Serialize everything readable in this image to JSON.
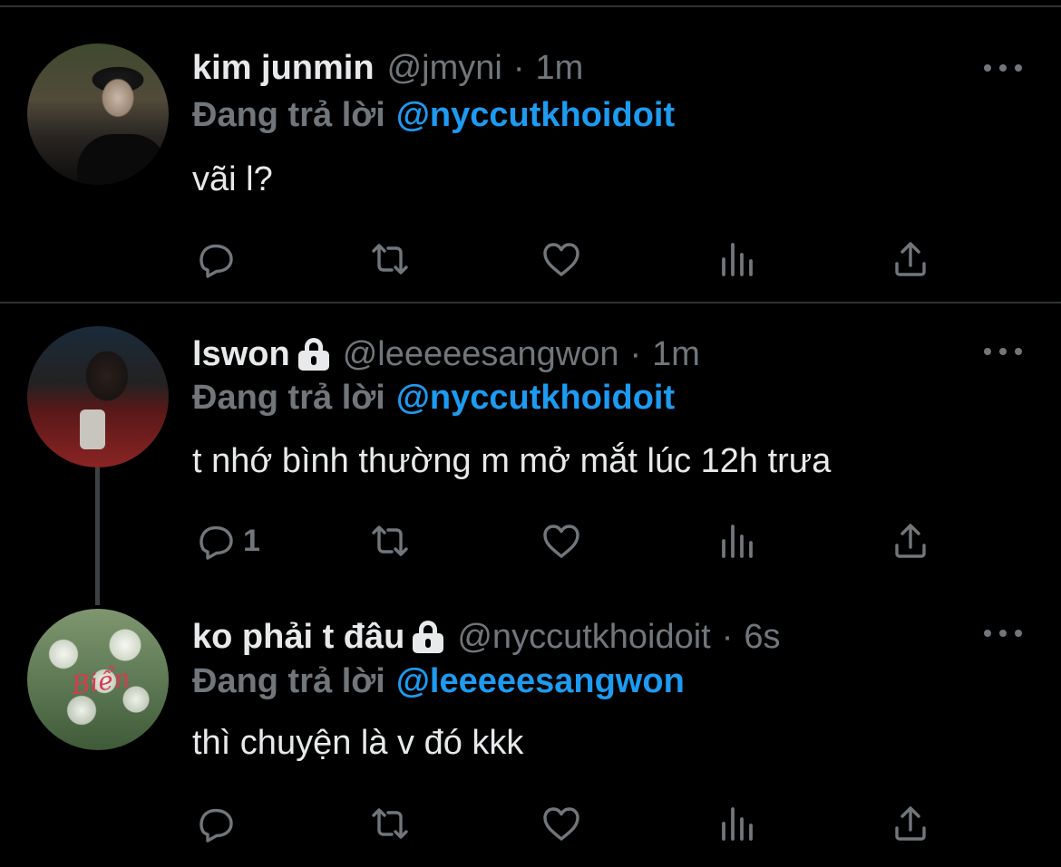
{
  "colors": {
    "background": "#000000",
    "text": "#e7e9ea",
    "muted": "#71767b",
    "link": "#1d9bf0",
    "divider": "#2f3336"
  },
  "reply_prefix": "Đang trả lời",
  "tweets": [
    {
      "name": "kim junmin",
      "handle": "@jmyni",
      "time": "1m",
      "protected": false,
      "reply_to": "@nyccutkhoidoit",
      "text": "vãi l?",
      "reply_count": ""
    },
    {
      "name": "lswon",
      "handle": "@leeeeesangwon",
      "time": "1m",
      "protected": true,
      "reply_to": "@nyccutkhoidoit",
      "text": "t nhớ bình thường m mở mắt lúc 12h trưa",
      "reply_count": "1"
    },
    {
      "name": "ko phải t đâu",
      "handle": "@nyccutkhoidoit",
      "time": "6s",
      "protected": true,
      "reply_to": "@leeeeesangwon",
      "text": "thì chuyện là v đó kkk",
      "reply_count": "",
      "avatar_text": "Biển"
    }
  ],
  "separator": "·",
  "icons": [
    "reply-icon",
    "retweet-icon",
    "like-icon",
    "analytics-icon",
    "share-icon",
    "more-icon",
    "lock-icon"
  ]
}
